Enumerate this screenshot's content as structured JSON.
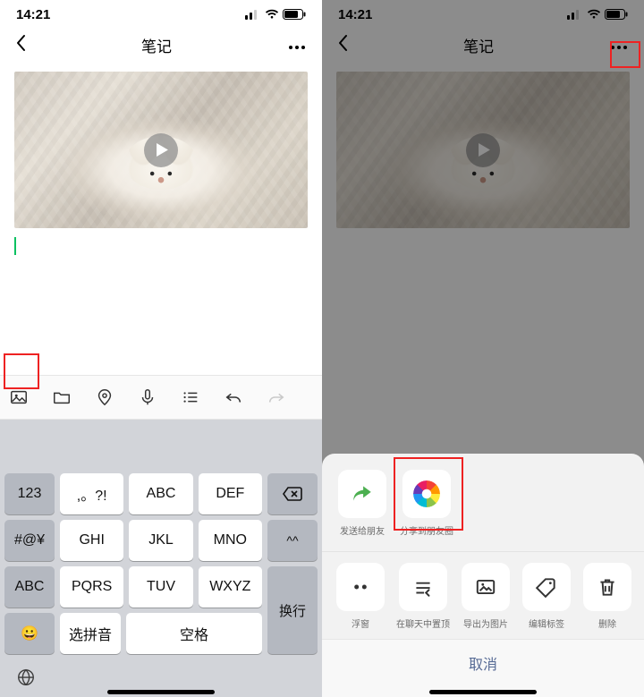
{
  "status": {
    "time": "14:21"
  },
  "header": {
    "title": "笔记"
  },
  "toolbar": {
    "items": [
      "image",
      "folder",
      "location",
      "voice",
      "list",
      "undo",
      "redo"
    ]
  },
  "keyboard": {
    "left": [
      "123",
      "#@¥",
      "ABC",
      "😀"
    ],
    "mid": [
      [
        ",。?!",
        "ABC",
        "DEF"
      ],
      [
        "GHI",
        "JKL",
        "MNO"
      ],
      [
        "PQRS",
        "TUV",
        "WXYZ"
      ],
      [
        "选拼音",
        "空格"
      ]
    ],
    "right": [
      "⌫",
      "^^",
      "换行"
    ]
  },
  "sheet": {
    "row1": [
      {
        "key": "send",
        "label": "发送给朋友"
      },
      {
        "key": "moments",
        "label": "分享到朋友圈"
      }
    ],
    "row2": [
      {
        "key": "float",
        "label": "浮窗"
      },
      {
        "key": "pin",
        "label": "在聊天中置顶"
      },
      {
        "key": "export",
        "label": "导出为图片"
      },
      {
        "key": "tag",
        "label": "编辑标签"
      },
      {
        "key": "delete",
        "label": "删除"
      }
    ],
    "cancel": "取消"
  }
}
